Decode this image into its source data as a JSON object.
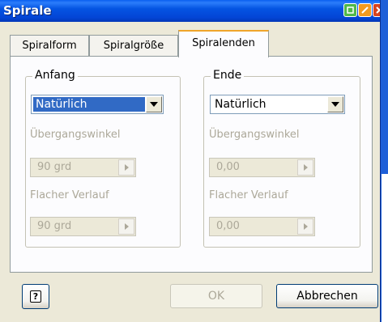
{
  "window": {
    "title": "Spirale"
  },
  "tabs": [
    {
      "label": "Spiralform"
    },
    {
      "label": "Spiralgröße"
    },
    {
      "label": "Spiralenden"
    }
  ],
  "start_group": {
    "legend": "Anfang",
    "type_value": "Natürlich",
    "transition_angle_label": "Übergangswinkel",
    "transition_angle_value": "90 grd",
    "flat_run_label": "Flacher Verlauf",
    "flat_run_value": "90 grd"
  },
  "end_group": {
    "legend": "Ende",
    "type_value": "Natürlich",
    "transition_angle_label": "Übergangswinkel",
    "transition_angle_value": "0,00",
    "flat_run_label": "Flacher Verlauf",
    "flat_run_value": "0,00"
  },
  "buttons": {
    "help": "?",
    "ok": "OK",
    "cancel": "Abbrechen"
  },
  "colors": {
    "titlebar": "#0454e2",
    "dialog_bg": "#ece9d8",
    "selection": "#316ac5",
    "active_tab_accent": "#f0a52a"
  }
}
